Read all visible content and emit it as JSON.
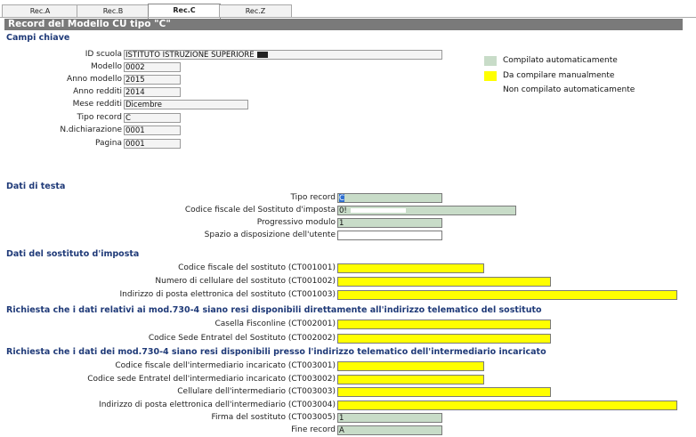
{
  "tabs": [
    {
      "label": "Rec.A",
      "active": false
    },
    {
      "label": "Rec.B",
      "active": false
    },
    {
      "label": "Rec.C",
      "active": true
    },
    {
      "label": "Rec.Z",
      "active": false
    }
  ],
  "title": "Record del Modello CU tipo \"C\"",
  "campi_chiave": {
    "heading": "Campi chiave",
    "fields": [
      {
        "label": "ID scuola",
        "value": "ISTITUTO ISTRUZIONE SUPERIORE"
      },
      {
        "label": "Modello",
        "value": "0002"
      },
      {
        "label": "Anno modello",
        "value": "2015"
      },
      {
        "label": "Anno redditi",
        "value": "2014"
      },
      {
        "label": "Mese redditi",
        "value": "Dicembre"
      },
      {
        "label": "Tipo record",
        "value": "C"
      },
      {
        "label": "N.dichiarazione",
        "value": "0001"
      },
      {
        "label": "Pagina",
        "value": "0001"
      }
    ]
  },
  "legend": [
    {
      "label": "Compilato automaticamente",
      "color": "#c8dcc8"
    },
    {
      "label": "Da compilare manualmente",
      "color": "#ffff00"
    },
    {
      "label": "Non compilato automaticamente",
      "color": "#ffffff"
    }
  ],
  "dati_testa": {
    "heading": "Dati di testa",
    "fields": [
      {
        "label": "Tipo record",
        "value": "C",
        "kind": "auto"
      },
      {
        "label": "Codice fiscale del Sostituto d'imposta",
        "value": "0!",
        "kind": "auto"
      },
      {
        "label": "Progressivo modulo",
        "value": "1",
        "kind": "auto"
      },
      {
        "label": "Spazio a disposizione dell'utente",
        "value": "",
        "kind": "none"
      }
    ]
  },
  "dati_sostituto": {
    "heading": "Dati del sostituto d'imposta",
    "fields": [
      {
        "label": "Codice fiscale del sostituto (CT001001)",
        "value": ""
      },
      {
        "label": "Numero di cellulare del sostituto (CT001002)",
        "value": ""
      },
      {
        "label": "Indirizzo di posta elettronica del sostituto (CT001003)",
        "value": ""
      }
    ]
  },
  "richiesta_sostituto": {
    "heading": "Richiesta che i dati relativi ai mod.730-4 siano resi disponibili direttamente all'indirizzo telematico del sostituto",
    "fields": [
      {
        "label": "Casella Fisconline (CT002001)",
        "value": ""
      },
      {
        "label": "Codice Sede Entratel del Sostituto (CT002002)",
        "value": ""
      }
    ]
  },
  "richiesta_intermediario": {
    "heading": "Richiesta che i dati dei mod.730-4 siano resi disponibili presso l'indirizzo telematico dell'intermediario incaricato",
    "fields": [
      {
        "label": "Codice fiscale dell'intermediario incaricato (CT003001)",
        "value": "",
        "kind": "manual"
      },
      {
        "label": "Codice sede Entratel dell'intermediario incaricato (CT003002)",
        "value": "",
        "kind": "manual"
      },
      {
        "label": "Cellulare dell'intermediario (CT003003)",
        "value": "",
        "kind": "manual"
      },
      {
        "label": "Indirizzo di posta elettronica dell'intermediario (CT003004)",
        "value": "",
        "kind": "manual"
      },
      {
        "label": "Firma del sostituto (CT003005)",
        "value": "1",
        "kind": "auto"
      },
      {
        "label": "Fine record",
        "value": "A",
        "kind": "auto"
      }
    ]
  }
}
